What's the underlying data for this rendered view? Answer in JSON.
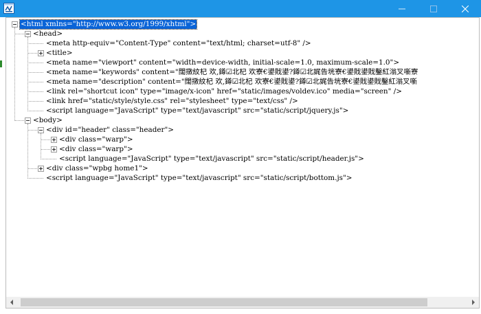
{
  "window": {
    "title": "",
    "app_icon": "xml-editor-icon",
    "controls": [
      "minimize-icon",
      "maximize-icon",
      "close-icon"
    ]
  },
  "tree": {
    "nodes": [
      {
        "id": "html",
        "depth": 0,
        "toggle": "minus",
        "text": "<html xmlns=\"http://www.w3.org/1999/xhtml\">",
        "selected": true
      },
      {
        "id": "head",
        "depth": 1,
        "toggle": "minus",
        "text": "<head>"
      },
      {
        "id": "meta-content-type",
        "depth": 2,
        "toggle": "none",
        "text": "<meta http-equiv=\"Content-Type\" content=\"text/html; charset=utf-8\" />"
      },
      {
        "id": "title",
        "depth": 2,
        "toggle": "plus",
        "text": "<title>"
      },
      {
        "id": "meta-viewport",
        "depth": 2,
        "toggle": "none",
        "text": "<meta name=\"viewport\" content=\"width=device-width, initial-scale=1.0, maximum-scale=1.0\">"
      },
      {
        "id": "meta-keywords",
        "depth": 2,
        "toggle": "none",
        "text": "<meta name=\"keywords\" content=\"闊撴紋杞  欢,鐏☑北杞  欢寮€鍙戝鍙?鐏☑北娓告垙寮€鍙戝鍙戝鑿紅滃叉噺寮"
      },
      {
        "id": "meta-description",
        "depth": 2,
        "toggle": "none",
        "text": "<meta name=\"description\" content=\"闊撴紋杞  欢,鐏☑北杞  欢寮€鍙戝鍙?鐏☑北娓告垙寮€鍙戝鍙戝鑿紅滃叉噺"
      },
      {
        "id": "link-icon",
        "depth": 2,
        "toggle": "none",
        "text": "<link rel=\"shortcut icon\" type=\"image/x-icon\" href=\"static/images/voldev.ico\" media=\"screen\" />"
      },
      {
        "id": "link-style",
        "depth": 2,
        "toggle": "none",
        "text": "<link href=\"static/style/style.css\" rel=\"stylesheet\" type=\"text/css\" />"
      },
      {
        "id": "script-jquery",
        "depth": 2,
        "toggle": "none",
        "text": "<script language=\"JavaScript\" type=\"text/javascript\" src=\"static/script/jquery.js\">"
      },
      {
        "id": "body",
        "depth": 1,
        "toggle": "minus",
        "text": "<body>"
      },
      {
        "id": "div-header",
        "depth": 2,
        "toggle": "minus",
        "text": "<div id=\"header\" class=\"header\">"
      },
      {
        "id": "div-warp-1",
        "depth": 3,
        "toggle": "plus",
        "text": "<div class=\"warp\">"
      },
      {
        "id": "div-warp-2",
        "depth": 3,
        "toggle": "plus",
        "text": "<div class=\"warp\">"
      },
      {
        "id": "script-header",
        "depth": 3,
        "toggle": "none",
        "text": "<script language=\"JavaScript\" type=\"text/javascript\" src=\"static/script/header.js\">"
      },
      {
        "id": "div-wpbg",
        "depth": 2,
        "toggle": "plus",
        "text": "<div class=\"wpbg home1\">"
      },
      {
        "id": "script-bottom",
        "depth": 2,
        "toggle": "none",
        "text": "<script language=\"JavaScript\" type=\"text/javascript\" src=\"static/script/bottom.js\">"
      }
    ]
  },
  "scrollbar": {
    "left_arrow": "scroll-left-icon",
    "right_arrow": "scroll-right-icon"
  }
}
